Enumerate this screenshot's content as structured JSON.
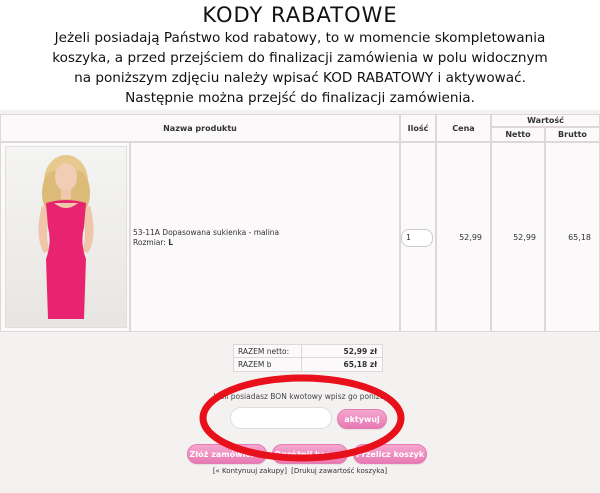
{
  "header": {
    "title": "KODY RABATOWE",
    "line1": "Jeżeli posiadają Państwo kod rabatowy, to w momencie skompletowania",
    "line2": "koszyka, a przed przejściem do finalizacji zamówienia w polu widocznym",
    "line3": "na poniższym zdjęciu należy wpisać KOD RABATOWY i aktywować.",
    "line4": "Następnie można przejść do finalizacji zamówienia."
  },
  "table": {
    "headers": {
      "product_name": "Nazwa produktu",
      "quantity": "Ilość",
      "price": "Cena",
      "value": "Wartość",
      "net": "Netto",
      "gross": "Brutto"
    },
    "row": {
      "name": "53-11A Dopasowana sukienka - malina",
      "size_label": "Rozmiar:",
      "size_value": "L",
      "quantity": "1",
      "price": "52,99",
      "net": "52,99",
      "gross": "65,18"
    }
  },
  "totals": {
    "net_label": "RAZEM netto:",
    "net_value": "52,99 zł",
    "gross_label": "RAZEM b",
    "gross_value": "65,18 zł"
  },
  "voucher": {
    "label": "Jeśli posiadasz BON kwotowy wpisz go poniżej",
    "input_value": "",
    "activate_label": "aktywuj"
  },
  "actions": {
    "order_label": "Złóż zamówienie",
    "empty_label": "Opróżnij koszyk",
    "recalc_label": "Przelicz koszyk"
  },
  "links": {
    "continue": "[« Kontynuuj zakupy]",
    "print": "[Drukuj zawartość koszyka]"
  },
  "colors": {
    "accent_pink": "#e879b4",
    "highlight_red": "#e8101a",
    "dress": "#e8236f"
  }
}
